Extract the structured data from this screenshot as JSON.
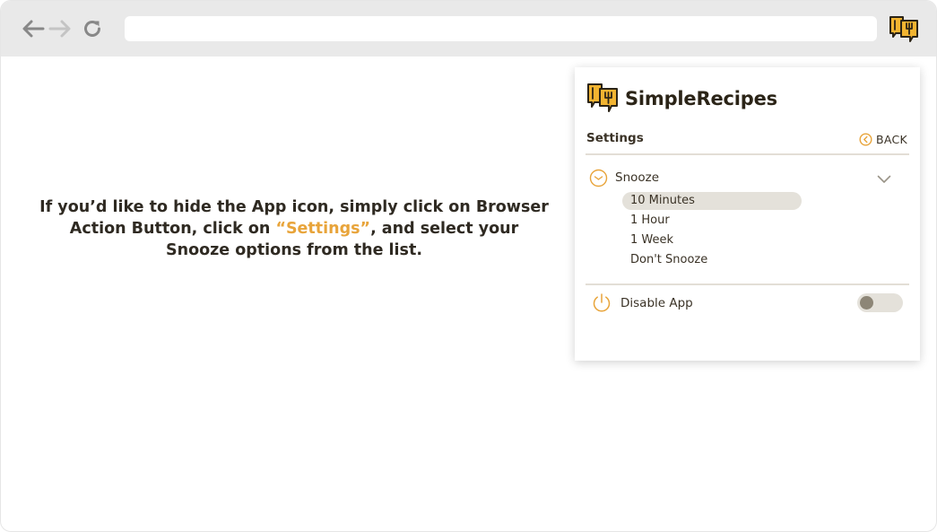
{
  "browser": {
    "url": "",
    "extension_icon": "simplerecipes-logo-icon"
  },
  "instruction": {
    "line_before": "If you’d like to hide the App icon, simply click on Browser Action Button, click on ",
    "highlight": "“Settings”",
    "line_after": ", and select your Snooze options from the list.",
    "highlight_color": "#e8a43a"
  },
  "popup": {
    "brand_name": "SimpleRecipes",
    "settings_title": "Settings",
    "back_label": "BACK",
    "snooze": {
      "label": "Snooze",
      "options": [
        "10 Minutes",
        "1 Hour",
        "1 Week",
        "Don't Snooze"
      ],
      "selected": "10 Minutes"
    },
    "disable_app": {
      "label": "Disable App",
      "enabled": false
    }
  },
  "colors": {
    "accent": "#e8a43a",
    "text": "#3a3226",
    "toolbar": "#e9e9e9",
    "selected_bg": "#e4e1da"
  }
}
